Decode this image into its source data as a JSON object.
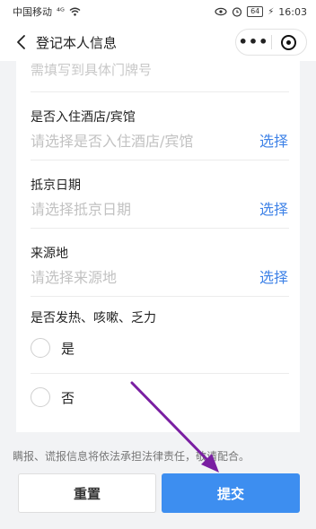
{
  "statusbar": {
    "carrier": "中国移动",
    "signal": "⁴ᴳ",
    "battery": "64",
    "time": "16:03"
  },
  "navbar": {
    "title": "登记本人信息",
    "more": "•••"
  },
  "form": {
    "address_hint": "需填写到具体门牌号",
    "hotel_label": "是否入住酒店/宾馆",
    "hotel_placeholder": "请选择是否入住酒店/宾馆",
    "arrival_label": "抵京日期",
    "arrival_placeholder": "请选择抵京日期",
    "origin_label": "来源地",
    "origin_placeholder": "请选择来源地",
    "select_label": "选择",
    "symptom_label": "是否发热、咳嗽、乏力",
    "option_yes": "是",
    "option_no": "否"
  },
  "notice": "瞒报、谎报信息将依法承担法律责任，敬请配合。",
  "buttons": {
    "reset": "重置",
    "submit": "提交"
  },
  "colors": {
    "accent": "#3e82e7",
    "submit_bg": "#3d8ef0",
    "annotation_arrow": "#7a1fa2"
  }
}
